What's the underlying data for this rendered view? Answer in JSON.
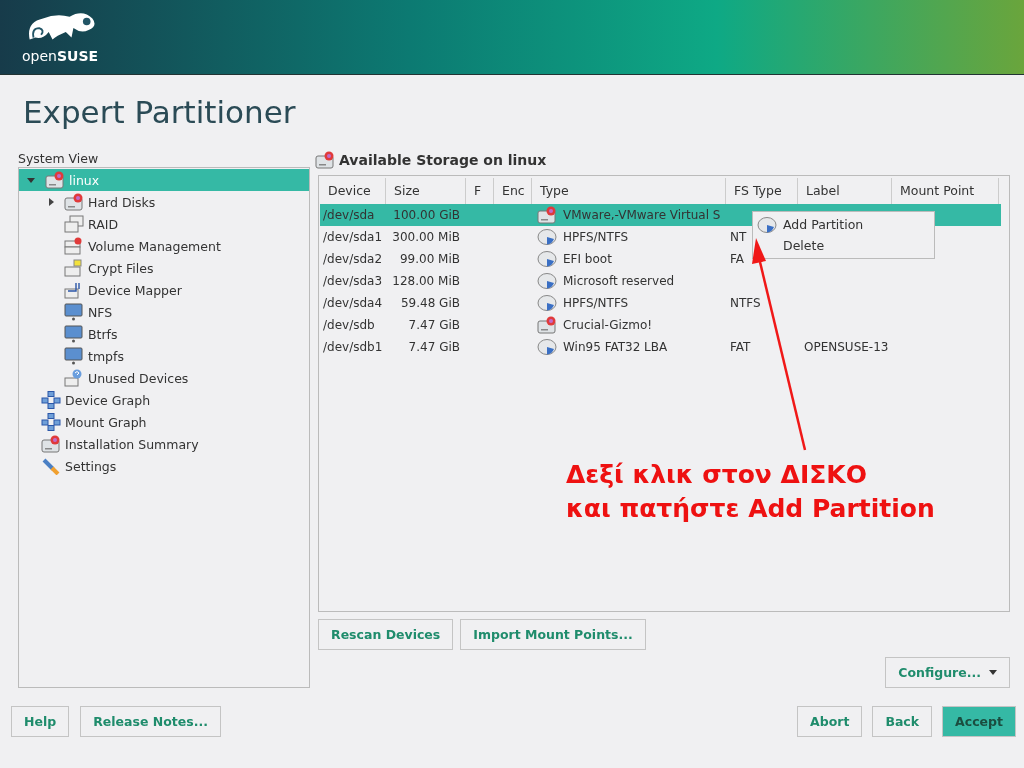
{
  "header": {
    "logo_text": "open**SUSE**"
  },
  "title": "Expert Partitioner",
  "system_view": {
    "label": "System View",
    "tree": [
      {
        "label": "linux",
        "kind": "disk",
        "selected": true,
        "expanded": true,
        "children": [
          {
            "label": "Hard Disks",
            "kind": "disk",
            "selected": false,
            "expanded": false
          },
          {
            "label": "RAID",
            "kind": "raid",
            "selected": false
          },
          {
            "label": "Volume Management",
            "kind": "volume",
            "selected": false
          },
          {
            "label": "Crypt Files",
            "kind": "crypt",
            "selected": false
          },
          {
            "label": "Device Mapper",
            "kind": "mapper",
            "selected": false
          },
          {
            "label": "NFS",
            "kind": "network",
            "selected": false
          },
          {
            "label": "Btrfs",
            "kind": "network",
            "selected": false
          },
          {
            "label": "tmpfs",
            "kind": "network",
            "selected": false
          },
          {
            "label": "Unused Devices",
            "kind": "unused",
            "selected": false
          }
        ]
      },
      {
        "label": "Device Graph",
        "kind": "graph",
        "selected": false
      },
      {
        "label": "Mount Graph",
        "kind": "graph",
        "selected": false
      },
      {
        "label": "Installation Summary",
        "kind": "disk",
        "selected": false
      },
      {
        "label": "Settings",
        "kind": "settings",
        "selected": false
      }
    ]
  },
  "storage": {
    "title": "Available Storage on linux",
    "columns": [
      "Device",
      "Size",
      "F",
      "Enc",
      "Type",
      "FS Type",
      "Label",
      "Mount Point"
    ],
    "rows": [
      {
        "device": "/dev/sda",
        "size": "100.00 GiB",
        "kind": "disk",
        "type": "VMware,-VMware Virtual S",
        "selected": true
      },
      {
        "device": "/dev/sda1",
        "size": "300.00 MiB",
        "kind": "partition",
        "type": "HPFS/NTFS",
        "fs_type": "NT",
        "selected": false
      },
      {
        "device": "/dev/sda2",
        "size": "99.00 MiB",
        "kind": "partition",
        "type": "EFI boot",
        "fs_type": "FA",
        "selected": false
      },
      {
        "device": "/dev/sda3",
        "size": "128.00 MiB",
        "kind": "partition",
        "type": "Microsoft reserved",
        "selected": false
      },
      {
        "device": "/dev/sda4",
        "size": "59.48 GiB",
        "kind": "partition",
        "type": "HPFS/NTFS",
        "fs_type": "NTFS",
        "selected": false
      },
      {
        "device": "/dev/sdb",
        "size": "7.47 GiB",
        "kind": "usb",
        "type": "Crucial-Gizmo!",
        "selected": false
      },
      {
        "device": "/dev/sdb1",
        "size": "7.47 GiB",
        "kind": "partition",
        "type": "Win95 FAT32 LBA",
        "fs_type": "FAT",
        "label": "OPENSUSE-13",
        "selected": false
      }
    ],
    "context_menu": [
      {
        "label": "Add Partition",
        "icon": true
      },
      {
        "label": "Delete",
        "icon": false
      }
    ],
    "buttons": [
      "Rescan Devices",
      "Import Mount Points..."
    ],
    "configure": "Configure..."
  },
  "annotation": [
    "Δεξί κλικ στον ΔΙΣΚΟ",
    "και πατήστε Add Partition"
  ],
  "footer": {
    "left": [
      "Help",
      "Release Notes..."
    ],
    "right": [
      {
        "label": "Abort",
        "primary": false
      },
      {
        "label": "Back",
        "primary": false
      },
      {
        "label": "Accept",
        "primary": true
      }
    ]
  }
}
